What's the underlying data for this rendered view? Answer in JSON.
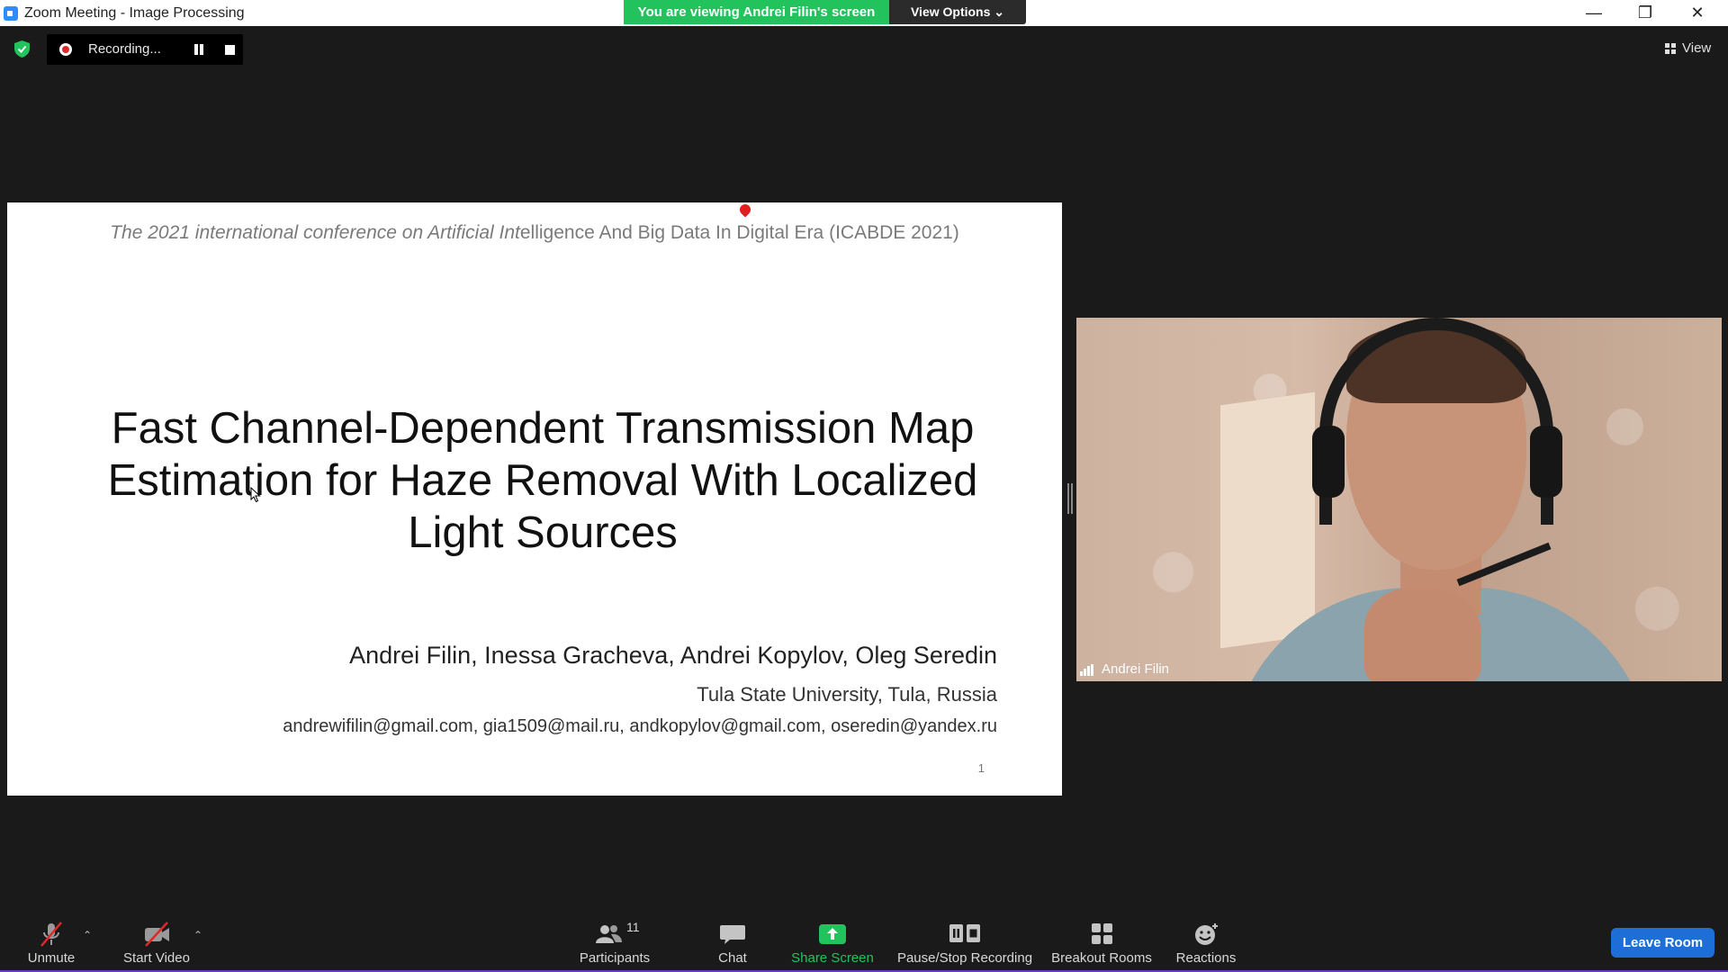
{
  "window": {
    "title": "Zoom Meeting - Image Processing",
    "minimize_glyph": "—",
    "restore_glyph": "❐",
    "close_glyph": "✕"
  },
  "banner": {
    "viewing_text": "You are viewing Andrei Filin's screen",
    "view_options_label": "View Options ⌄",
    "banner_color": "#22c35d"
  },
  "recording": {
    "label": "Recording..."
  },
  "view_button": {
    "label": "View"
  },
  "slide": {
    "header_italic": "The 2021 international conference on Artificial Int",
    "header_rest": "elligence And Big Data In Digital Era (ICABDE 2021)",
    "title_lines": [
      "Fast Channel-Dependent Transmission Map",
      "Estimation for Haze Removal With Localized",
      "Light Sources"
    ],
    "authors": "Andrei Filin, Inessa Gracheva, Andrei Kopylov, Oleg Seredin",
    "affiliation": "Tula State University, Tula, Russia",
    "emails": "andrewifilin@gmail.com, gia1509@mail.ru, andkopylov@gmail.com, oseredin@yandex.ru",
    "page_number": "1"
  },
  "video": {
    "participant_name": "Andrei Filin"
  },
  "toolbar": {
    "unmute_label": "Unmute",
    "start_video_label": "Start Video",
    "participants_label": "Participants",
    "participants_count": "11",
    "chat_label": "Chat",
    "share_screen_label": "Share Screen",
    "recording_label": "Pause/Stop Recording",
    "breakout_label": "Breakout Rooms",
    "reactions_label": "Reactions",
    "leave_label": "Leave Room",
    "share_color": "#22c35d",
    "leave_color": "#1e6ed8"
  }
}
